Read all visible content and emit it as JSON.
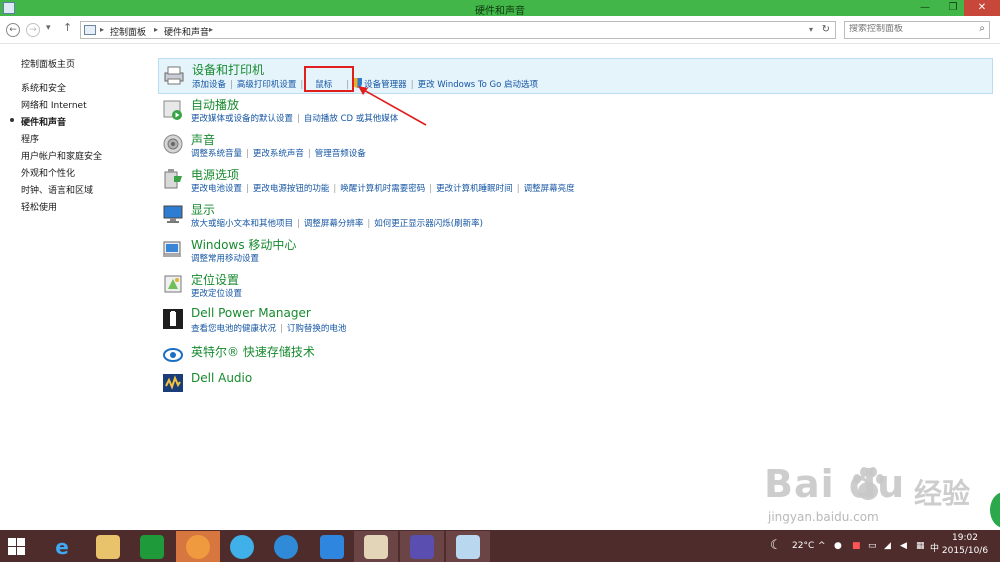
{
  "window": {
    "title": "硬件和声音",
    "minimize_glyph": "—",
    "restore_glyph": "❐",
    "close_glyph": "✕"
  },
  "nav": {
    "back_glyph": "←",
    "forward_glyph": "→",
    "history_glyph": "▾",
    "up_glyph": "↑",
    "breadcrumb": [
      "控制面板",
      "硬件和声音"
    ],
    "breadcrumb_sep": "▸",
    "dropdown_glyph": "▾",
    "refresh_glyph": "↻",
    "search_placeholder": "搜索控制面板",
    "search_glyph": "⌕"
  },
  "sidebar": {
    "items": [
      {
        "label": "控制面板主页"
      },
      {
        "label": "系统和安全"
      },
      {
        "label": "网络和 Internet"
      },
      {
        "label": "硬件和声音"
      },
      {
        "label": "程序"
      },
      {
        "label": "用户帐户和家庭安全"
      },
      {
        "label": "外观和个性化"
      },
      {
        "label": "时钟、语言和区域"
      },
      {
        "label": "轻松使用"
      }
    ]
  },
  "categories": [
    {
      "title": "设备和打印机",
      "icon": "printer-icon",
      "links": [
        "添加设备",
        "高级打印机设置",
        "鼠标",
        "设备管理器",
        "更改 Windows To Go 启动选项"
      ]
    },
    {
      "title": "自动播放",
      "icon": "autoplay-icon",
      "links": [
        "更改媒体或设备的默认设置",
        "自动播放 CD 或其他媒体"
      ]
    },
    {
      "title": "声音",
      "icon": "speaker-icon",
      "links": [
        "调整系统音量",
        "更改系统声音",
        "管理音频设备"
      ]
    },
    {
      "title": "电源选项",
      "icon": "power-options-icon",
      "links": [
        "更改电池设置",
        "更改电源按钮的功能",
        "唤醒计算机时需要密码",
        "更改计算机睡眠时间",
        "调整屏幕亮度"
      ]
    },
    {
      "title": "显示",
      "icon": "display-icon",
      "links": [
        "放大或缩小文本和其他项目",
        "调整屏幕分辨率",
        "如何更正显示器闪烁(刷新率)"
      ]
    },
    {
      "title": "Windows 移动中心",
      "icon": "mobility-center-icon",
      "links": [
        "调整常用移动设置"
      ]
    },
    {
      "title": "定位设置",
      "icon": "location-icon",
      "links": [
        "更改定位设置"
      ]
    },
    {
      "title": "Dell Power Manager",
      "icon": "dell-power-icon",
      "links": [
        "查看您电池的健康状况",
        "订购替换的电池"
      ]
    },
    {
      "title": "英特尔® 快速存储技术",
      "icon": "intel-rst-icon",
      "links": []
    },
    {
      "title": "Dell Audio",
      "icon": "dell-audio-icon",
      "links": []
    }
  ],
  "watermark": {
    "logo": "Bai  du",
    "cn": "经验",
    "url": "jingyan.baidu.com"
  },
  "taskbar": {
    "apps": [
      "ie-icon",
      "file-explorer-icon",
      "store-icon",
      "app-orange-icon",
      "browser-icon",
      "cloud-icon",
      "app-blue-icon",
      "paint-icon",
      "settings-icon",
      "control-panel-icon"
    ],
    "tray": {
      "temperature": "22°C",
      "ime": "中",
      "time": "19:02",
      "date": "2015/10/6"
    }
  },
  "colors": {
    "titlebar": "#43b649",
    "taskbar": "#4e2c2c",
    "link": "#1556a3",
    "category_title": "#178a2f",
    "highlight_box": "#e01e1e"
  }
}
